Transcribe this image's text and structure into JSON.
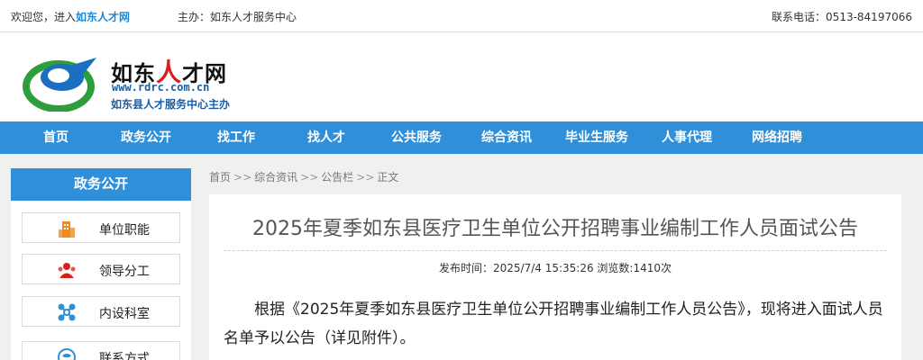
{
  "topbar": {
    "welcome_prefix": "欢迎您，进入",
    "site_name": "如东人才网",
    "host": "主办：如东人才服务中心",
    "phone": "联系电话：0513-84197066"
  },
  "header": {
    "logo_cn_a": "如东",
    "logo_cn_accent": "人",
    "logo_cn_b": "才网",
    "logo_url": "www.rdrc.com.cn",
    "logo_slogan": "如东县人才服务中心主办"
  },
  "nav": {
    "items": [
      {
        "label": "首页"
      },
      {
        "label": "政务公开"
      },
      {
        "label": "找工作"
      },
      {
        "label": "找人才"
      },
      {
        "label": "公共服务"
      },
      {
        "label": "综合资讯"
      },
      {
        "label": "毕业生服务"
      },
      {
        "label": "人事代理"
      },
      {
        "label": "网络招聘"
      }
    ]
  },
  "sidebar": {
    "title": "政务公开",
    "items": [
      {
        "label": "单位职能",
        "icon": "building-icon"
      },
      {
        "label": "领导分工",
        "icon": "people-icon"
      },
      {
        "label": "内设科室",
        "icon": "org-chart-icon"
      },
      {
        "label": "联系方式",
        "icon": "phone-icon"
      }
    ]
  },
  "breadcrumb": {
    "items": [
      "首页",
      "综合资讯",
      "公告栏",
      "正文"
    ],
    "separator": ">>"
  },
  "article": {
    "title": "2025年夏季如东县医疗卫生单位公开招聘事业编制工作人员面试公告",
    "meta": "发布时间：2025/7/4 15:35:26 浏览数:1410次",
    "body": "根据《2025年夏季如东县医疗卫生单位公开招聘事业编制工作人员公告》，现将进入面试人员名单予以公告（详见附件）。"
  },
  "colors": {
    "nav_blue": "#2f8fd8",
    "link_blue": "#1e88d6",
    "icon_orange": "#f08a1c",
    "icon_red": "#d7201b",
    "icon_blue": "#2f8fd8"
  }
}
